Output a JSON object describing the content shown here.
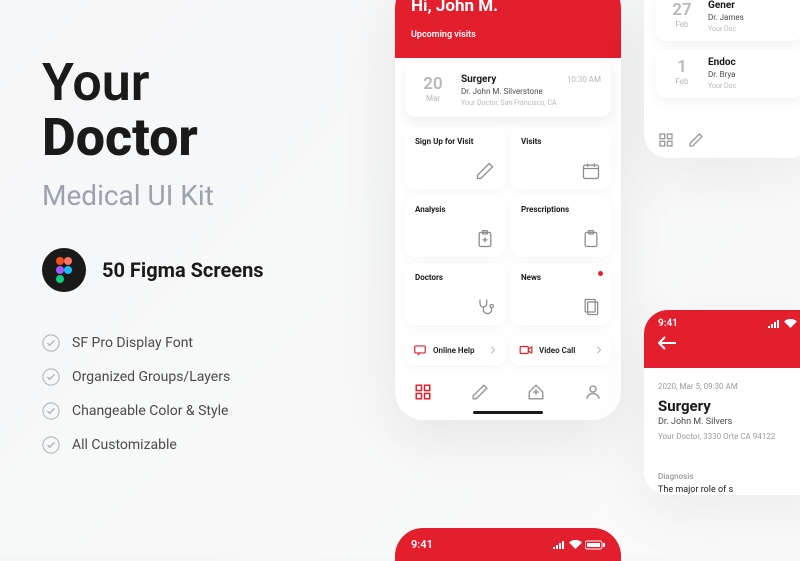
{
  "left": {
    "title1": "Your",
    "title2": "Doctor",
    "subtitle": "Medical UI Kit",
    "figma_count": "50 Figma Screens",
    "features": [
      "SF Pro Display Font",
      "Organized Groups/Layers",
      "Changeable Color & Style",
      "All Customizable"
    ]
  },
  "phone1": {
    "greeting": "Hi, John M.",
    "upcoming_label": "Upcoming visits",
    "visit": {
      "day": "20",
      "month": "Mar",
      "title": "Surgery",
      "time": "10:30 AM",
      "doctor": "Dr. John M. Silverstone",
      "location": "Your Doctor, San Francisco, CA"
    },
    "tiles": [
      {
        "label": "Sign Up for Visit"
      },
      {
        "label": "Visits"
      },
      {
        "label": "Analysis"
      },
      {
        "label": "Prescriptions"
      },
      {
        "label": "Doctors"
      },
      {
        "label": "News"
      }
    ],
    "help": [
      {
        "label": "Online Help"
      },
      {
        "label": "Video Call"
      }
    ]
  },
  "phone2": {
    "cards": [
      {
        "day": "27",
        "month": "Feb",
        "title": "Gener",
        "doctor": "Dr. James",
        "loc": "Your Doc"
      },
      {
        "day": "1",
        "month": "Feb",
        "title": "Endoc",
        "doctor": "Dr. Brya",
        "loc": "Your Doc"
      }
    ]
  },
  "phone3": {
    "time": "9:41",
    "meta": "2020, Mar 5, 09:30 AM",
    "title": "Surgery",
    "doctor": "Dr. John M. Silvers",
    "loc": "Your Doctor, 3330 Orte\nCA 94122",
    "section": "Diagnosis",
    "diag": "The major role of s"
  },
  "phone4": {
    "time": "9:41"
  }
}
